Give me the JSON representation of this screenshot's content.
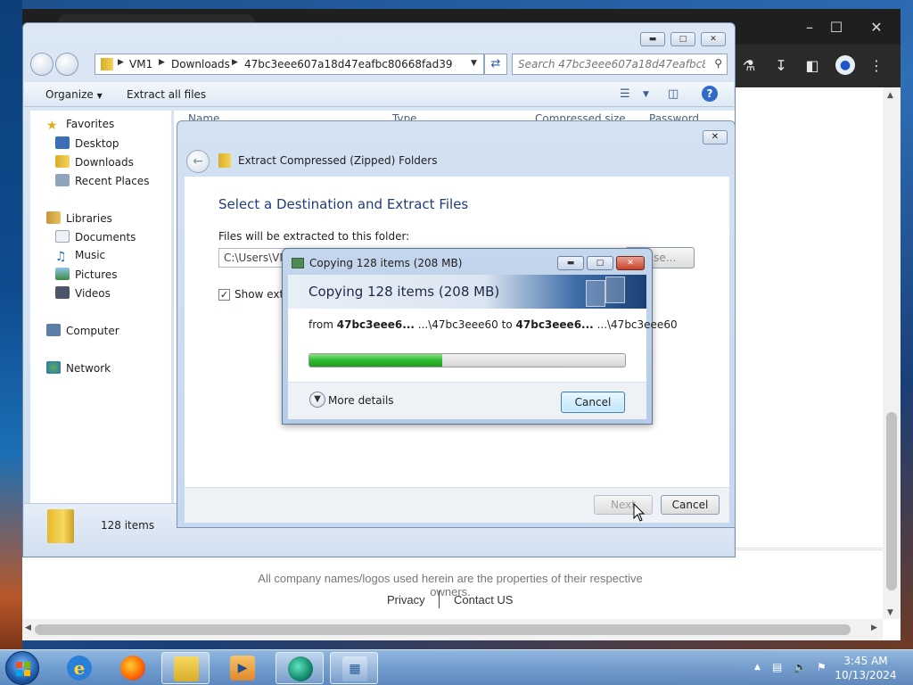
{
  "browser": {
    "footer_text": "All company names/logos used herein are the properties of their respective owners.",
    "links": [
      "Privacy",
      "Contact US"
    ]
  },
  "explorer": {
    "breadcrumb": [
      "VM1",
      "Downloads",
      "47bc3eee607a18d47eafbc80668fad39"
    ],
    "search_placeholder": "Search 47bc3eee607a18d47eafbc8066...",
    "toolbar": {
      "organize": "Organize",
      "extract_all": "Extract all files"
    },
    "nav": {
      "favorites": "Favorites",
      "desktop": "Desktop",
      "downloads": "Downloads",
      "recent": "Recent Places",
      "libraries": "Libraries",
      "documents": "Documents",
      "music": "Music",
      "pictures": "Pictures",
      "videos": "Videos",
      "computer": "Computer",
      "network": "Network"
    },
    "columns": [
      "Name",
      "Type",
      "Compressed size",
      "Password"
    ],
    "status_items": "128 items"
  },
  "wizard": {
    "title": "Extract Compressed (Zipped) Folders",
    "heading": "Select a Destination and Extract Files",
    "folder_label": "Files will be extracted to this folder:",
    "path": "C:\\Users\\VM",
    "browse_label": "...se...",
    "show_label": "Show extra",
    "next_label": "Next",
    "cancel_label": "Cancel"
  },
  "copy_dialog": {
    "title": "Copying 128 items (208 MB)",
    "banner": "Copying 128 items (208 MB)",
    "from_word": "from",
    "src_bold": "47bc3eee6...",
    "src_path": "...\\47bc3eee60",
    "to_word": "to",
    "dst_bold": "47bc3eee6...",
    "dst_path": "...\\47bc3eee60",
    "progress": 0.42,
    "more_details": "More details",
    "cancel_label": "Cancel"
  },
  "taskbar": {
    "time": "3:45 AM",
    "date": "10/13/2024"
  },
  "colors": {
    "progress_green": "#2dbb2d",
    "heading_blue": "#1e3d7a",
    "copy_close_red": "#c8402b"
  }
}
